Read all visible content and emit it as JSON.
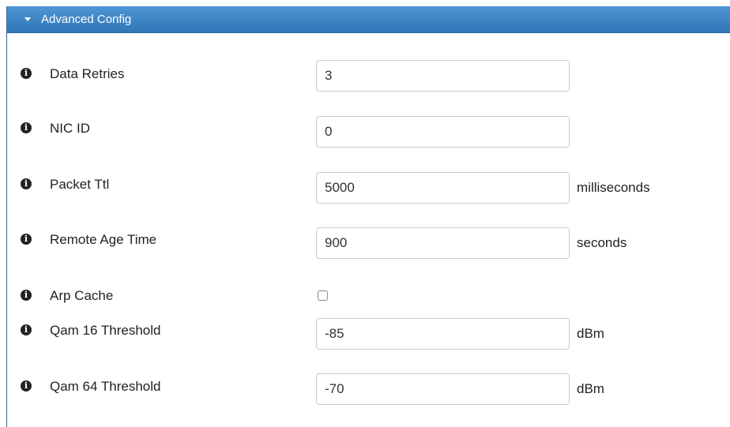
{
  "panel": {
    "title": "Advanced Config"
  },
  "fields": [
    {
      "label": "Data Retries",
      "value": "3",
      "unit": ""
    },
    {
      "label": "NIC ID",
      "value": "0",
      "unit": ""
    },
    {
      "label": "Packet Ttl",
      "value": "5000",
      "unit": "milliseconds"
    },
    {
      "label": "Remote Age Time",
      "value": "900",
      "unit": "seconds"
    },
    {
      "label": "Arp Cache",
      "checked": false
    },
    {
      "label": "Qam 16 Threshold",
      "value": "-85",
      "unit": "dBm"
    },
    {
      "label": "Qam 64 Threshold",
      "value": "-70",
      "unit": "dBm"
    }
  ],
  "icons": {
    "info": "info-circle-icon",
    "caret": "caret-down-icon"
  },
  "colors": {
    "header_top": "#4e95d3",
    "header_bottom": "#3177b8",
    "text": "#222222"
  }
}
